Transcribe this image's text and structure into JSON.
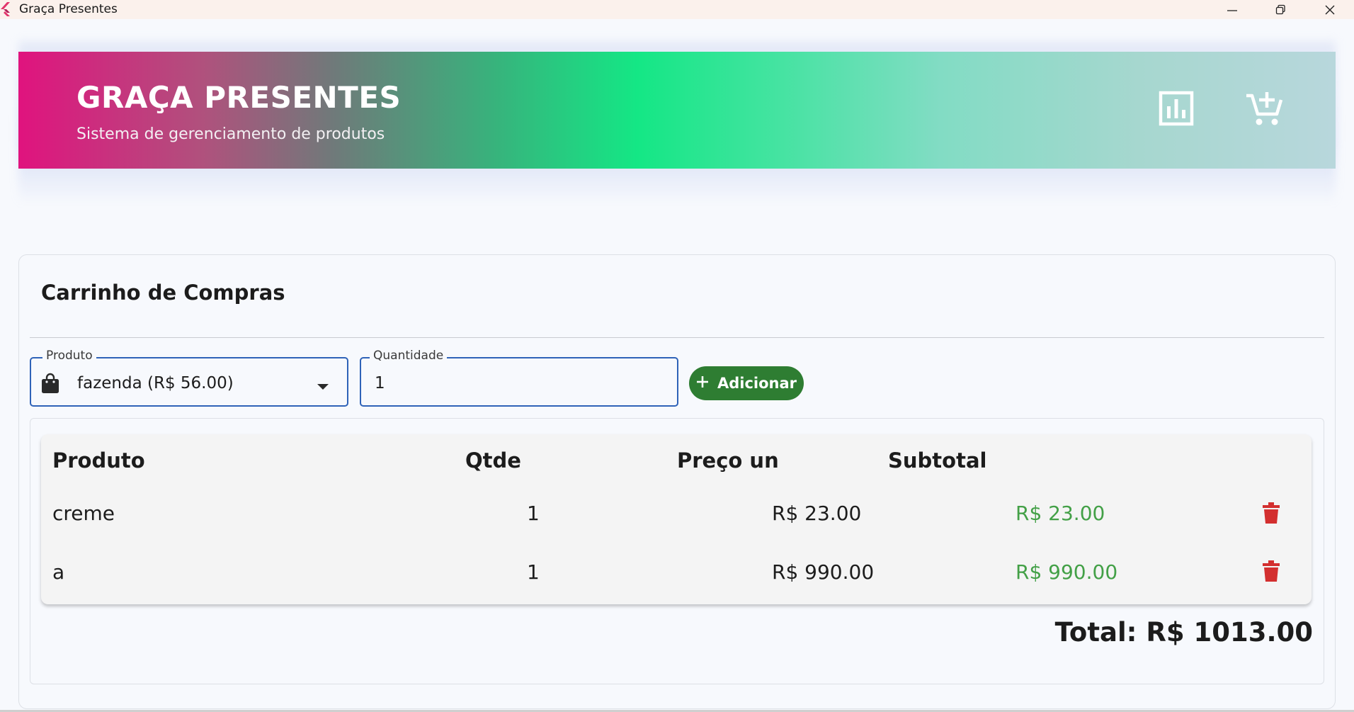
{
  "window": {
    "title": "Graça Presentes",
    "app_icon": "flutter-logo-icon",
    "controls": [
      "minimize-icon",
      "restore-icon",
      "close-icon"
    ]
  },
  "header": {
    "title": "GRAÇA PRESENTES",
    "subtitle": "Sistema de gerenciamento de produtos",
    "actions": [
      {
        "icon": "bar-chart-icon"
      },
      {
        "icon": "add-to-cart-icon"
      }
    ],
    "gradient_colors": [
      "#e0137e",
      "#14e785",
      "#b8d7dc"
    ]
  },
  "cart": {
    "title": "Carrinho de Compras",
    "product_field": {
      "label": "Produto",
      "value": "fazenda (R$ 56.00)",
      "icon": "shopping-bag-icon"
    },
    "quantity_field": {
      "label": "Quantidade",
      "value": "1"
    },
    "add_button": {
      "label": "Adicionar",
      "icon": "plus-icon",
      "color": "#2e7d32"
    },
    "table": {
      "headers": [
        "Produto",
        "Qtde",
        "Preço un",
        "Subtotal"
      ],
      "rows": [
        {
          "produto": "creme",
          "qtde": "1",
          "preco": "R$ 23.00",
          "subtotal": "R$ 23.00"
        },
        {
          "produto": "a",
          "qtde": "1",
          "preco": "R$ 990.00",
          "subtotal": "R$ 990.00"
        }
      ],
      "subtotal_color": "#43a047",
      "delete_icon": "trash-icon",
      "delete_color": "#d32f2f"
    },
    "total": "Total: R$ 1013.00"
  }
}
